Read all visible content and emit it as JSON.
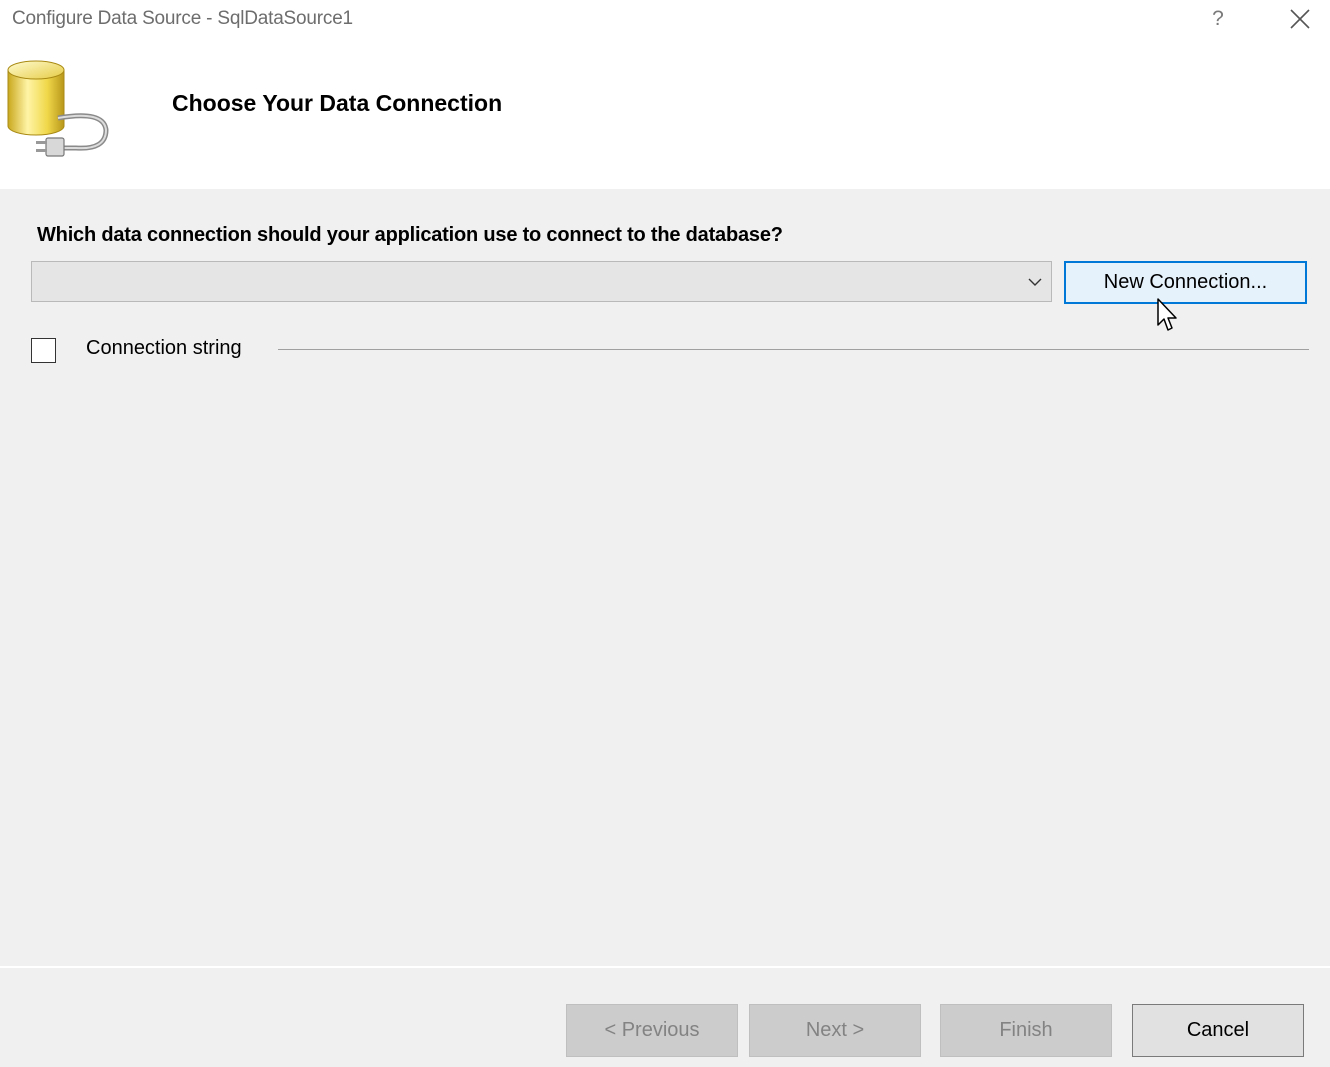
{
  "window": {
    "title": "Configure Data Source - SqlDataSource1",
    "help_label": "?"
  },
  "header": {
    "heading": "Choose Your Data Connection",
    "icon": "database-plug-icon"
  },
  "content": {
    "question": "Which data connection should your application use to connect to the database?",
    "connection_combo": {
      "value": "",
      "options": []
    },
    "new_connection_label": "New Connection...",
    "connection_string": {
      "label": "Connection string",
      "checked": false
    }
  },
  "footer": {
    "previous_label": "< Previous",
    "next_label": "Next >",
    "finish_label": "Finish",
    "cancel_label": "Cancel"
  },
  "colors": {
    "background": "#f0f0f0",
    "header_background": "#ffffff",
    "accent_border": "#0078d7",
    "focused_button_bg": "#e5f1fb",
    "disabled_button_bg": "#cccccc",
    "disabled_text": "#838383",
    "title_text": "#6d6d6d"
  }
}
